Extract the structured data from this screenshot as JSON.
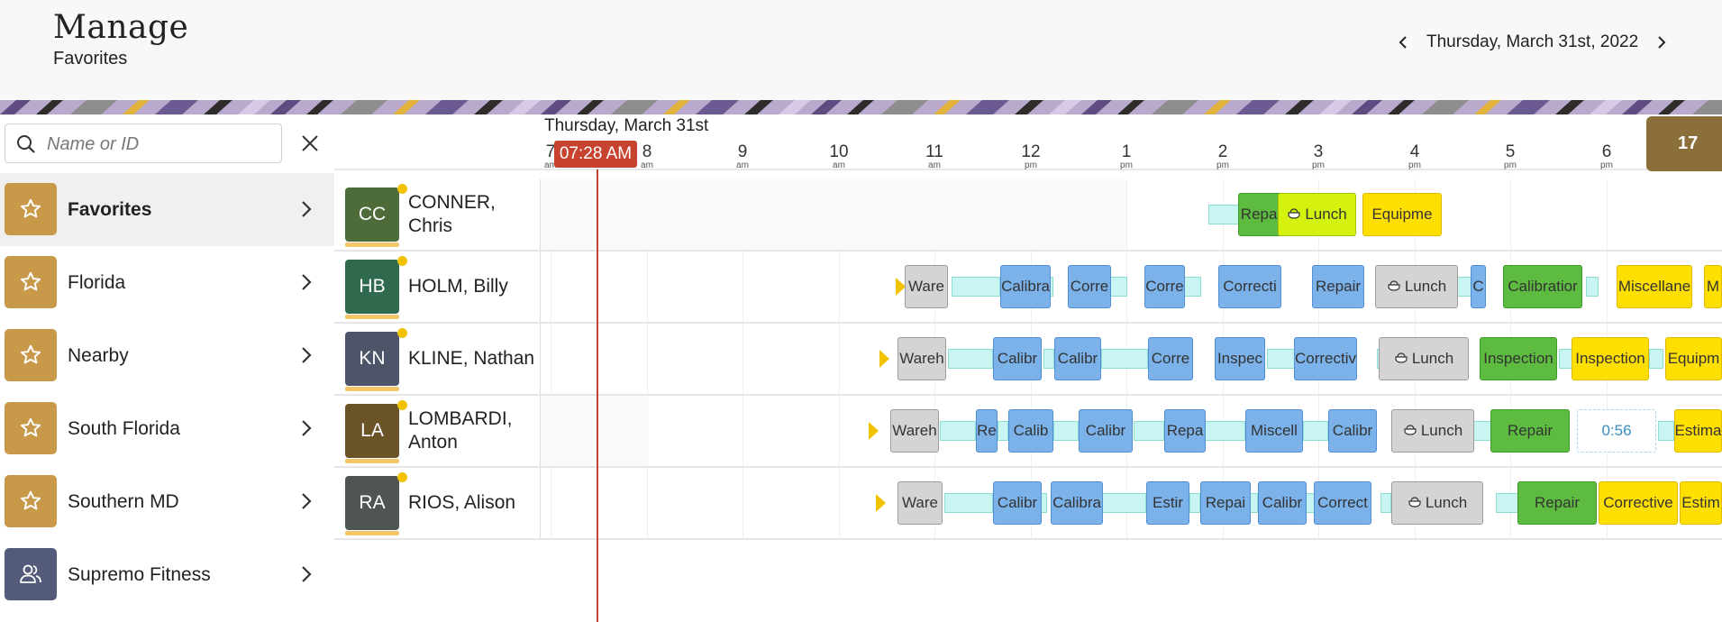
{
  "header": {
    "title": "Manage",
    "subtitle": "Favorites",
    "date": "Thursday, March 31st, 2022"
  },
  "search": {
    "placeholder": "Name or ID",
    "value": ""
  },
  "groups": [
    {
      "label": "Favorites",
      "icon": "star-icon",
      "selected": true,
      "color": "#c9994a"
    },
    {
      "label": "Florida",
      "icon": "star-icon",
      "selected": false,
      "color": "#c9994a"
    },
    {
      "label": "Nearby",
      "icon": "star-icon",
      "selected": false,
      "color": "#c9994a"
    },
    {
      "label": "South Florida",
      "icon": "star-icon",
      "selected": false,
      "color": "#c9994a"
    },
    {
      "label": "Southern MD",
      "icon": "star-icon",
      "selected": false,
      "color": "#c9994a"
    },
    {
      "label": "Supremo Fitness",
      "icon": "people-icon",
      "selected": false,
      "color": "#545a7a"
    }
  ],
  "timeline": {
    "date": "Thursday, March 31st",
    "current_time": "07:28 AM",
    "count": "17",
    "ticks": [
      {
        "hour": "7",
        "ampm": "am"
      },
      {
        "hour": "8",
        "ampm": "am"
      },
      {
        "hour": "9",
        "ampm": "am"
      },
      {
        "hour": "10",
        "ampm": "am"
      },
      {
        "hour": "11",
        "ampm": "am"
      },
      {
        "hour": "12",
        "ampm": "pm"
      },
      {
        "hour": "1",
        "ampm": "pm"
      },
      {
        "hour": "2",
        "ampm": "pm"
      },
      {
        "hour": "3",
        "ampm": "pm"
      },
      {
        "hour": "4",
        "ampm": "pm"
      },
      {
        "hour": "5",
        "ampm": "pm"
      },
      {
        "hour": "6",
        "ampm": "pm"
      }
    ]
  },
  "colors": {
    "repair": "#5dbb3f",
    "calibration": "#7bb2ea",
    "lunch_gray": "#d4d4d4",
    "lunch_lime": "#d4f20e",
    "yellow": "#ffdf00",
    "travel": "#c9f6f2",
    "now": "#c8432f"
  },
  "technicians": [
    {
      "initials": "CC",
      "name": "CONNER, Chris",
      "avatar_color": "#4e6b3a",
      "jobs": [
        {
          "label": "Repai",
          "kind": "repair"
        },
        {
          "label": "Lunch",
          "kind": "lunch-lime",
          "icon": "pot-icon"
        },
        {
          "label": "Equipme",
          "kind": "yellow"
        }
      ]
    },
    {
      "initials": "HB",
      "name": "HOLM, Billy",
      "avatar_color": "#2f6a4f",
      "jobs": [
        {
          "label": "Ware",
          "kind": "gray"
        },
        {
          "label": "Calibra",
          "kind": "blue"
        },
        {
          "label": "Corre",
          "kind": "blue"
        },
        {
          "label": "Corre",
          "kind": "blue"
        },
        {
          "label": "Correcti",
          "kind": "blue"
        },
        {
          "label": "Repair",
          "kind": "blue"
        },
        {
          "label": "Lunch",
          "kind": "gray",
          "icon": "pot-icon"
        },
        {
          "label": "C",
          "kind": "blue"
        },
        {
          "label": "Calibratior",
          "kind": "repair"
        },
        {
          "label": "Miscellane",
          "kind": "yellow"
        },
        {
          "label": "M",
          "kind": "yellow"
        }
      ]
    },
    {
      "initials": "KN",
      "name": "KLINE, Nathan",
      "avatar_color": "#4e5568",
      "jobs": [
        {
          "label": "Wareh",
          "kind": "gray"
        },
        {
          "label": "Calibr",
          "kind": "blue"
        },
        {
          "label": "Calibr",
          "kind": "blue"
        },
        {
          "label": "Corre",
          "kind": "blue"
        },
        {
          "label": "Inspec",
          "kind": "blue"
        },
        {
          "label": "Correctiv",
          "kind": "blue"
        },
        {
          "label": "Lunch",
          "kind": "gray",
          "icon": "pot-icon"
        },
        {
          "label": "Inspection",
          "kind": "repair"
        },
        {
          "label": "Inspection",
          "kind": "yellow"
        },
        {
          "label": "Equipm",
          "kind": "yellow"
        }
      ]
    },
    {
      "initials": "LA",
      "name": "LOMBARDI, Anton",
      "avatar_color": "#6b5328",
      "jobs": [
        {
          "label": "Wareh",
          "kind": "gray"
        },
        {
          "label": "Re",
          "kind": "blue"
        },
        {
          "label": "Calib",
          "kind": "blue"
        },
        {
          "label": "Calibr",
          "kind": "blue"
        },
        {
          "label": "Repa",
          "kind": "blue"
        },
        {
          "label": "Miscell",
          "kind": "blue"
        },
        {
          "label": "Calibr",
          "kind": "blue"
        },
        {
          "label": "Lunch",
          "kind": "gray",
          "icon": "pot-icon"
        },
        {
          "label": "Repair",
          "kind": "repair"
        },
        {
          "label": "0:56",
          "kind": "gap"
        },
        {
          "label": "Estima",
          "kind": "yellow"
        }
      ]
    },
    {
      "initials": "RA",
      "name": "RIOS, Alison",
      "avatar_color": "#4f5550",
      "jobs": [
        {
          "label": "Ware",
          "kind": "gray"
        },
        {
          "label": "Calibr",
          "kind": "blue"
        },
        {
          "label": "Calibra",
          "kind": "blue"
        },
        {
          "label": "Estir",
          "kind": "blue"
        },
        {
          "label": "Repai",
          "kind": "blue"
        },
        {
          "label": "Calibr",
          "kind": "blue"
        },
        {
          "label": "Correct",
          "kind": "blue"
        },
        {
          "label": "Lunch",
          "kind": "gray",
          "icon": "pot-icon"
        },
        {
          "label": "Repair",
          "kind": "repair"
        },
        {
          "label": "Corrective",
          "kind": "yellow"
        },
        {
          "label": "Estim",
          "kind": "yellow"
        }
      ]
    }
  ]
}
